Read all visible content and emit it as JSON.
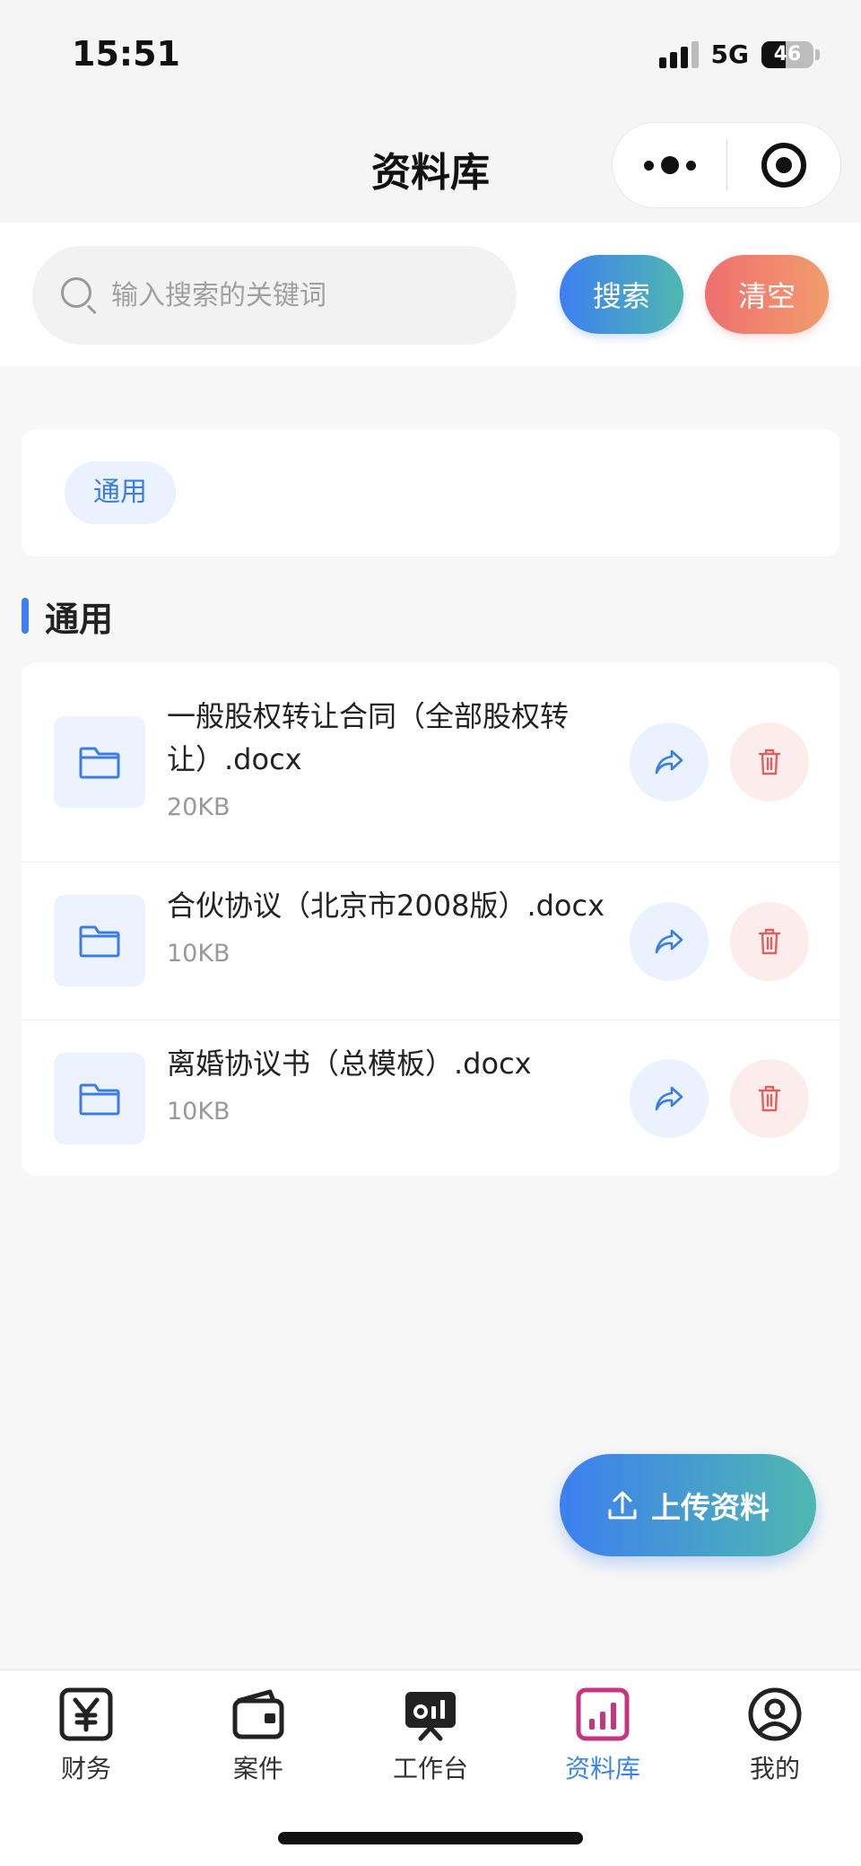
{
  "status_bar": {
    "time": "15:51",
    "network": "5G",
    "battery": "46",
    "battery_level": 0.46
  },
  "nav": {
    "title": "资料库"
  },
  "search": {
    "placeholder": "输入搜索的关键词",
    "value": "",
    "search_label": "搜索",
    "clear_label": "清空"
  },
  "categories": [
    {
      "label": "通用"
    }
  ],
  "section": {
    "title": "通用"
  },
  "files": [
    {
      "name": "一般股权转让合同（全部股权转让）.docx",
      "size": "20KB"
    },
    {
      "name": "合伙协议（北京市2008版）.docx",
      "size": "10KB"
    },
    {
      "name": "离婚协议书（总模板）.docx",
      "size": "10KB"
    }
  ],
  "upload": {
    "label": "上传资料"
  },
  "tabs": [
    {
      "label": "财务",
      "icon": "yen-icon"
    },
    {
      "label": "案件",
      "icon": "wallet-icon"
    },
    {
      "label": "工作台",
      "icon": "workbench-icon"
    },
    {
      "label": "资料库",
      "icon": "chart-icon",
      "active": true
    },
    {
      "label": "我的",
      "icon": "user-icon"
    }
  ],
  "colors": {
    "accent": "#3d7ff0",
    "accent_end": "#4fb8b0",
    "danger": "#ee6f6f",
    "danger_end": "#f29c6d",
    "active_tab_icon": "#c8357f"
  }
}
